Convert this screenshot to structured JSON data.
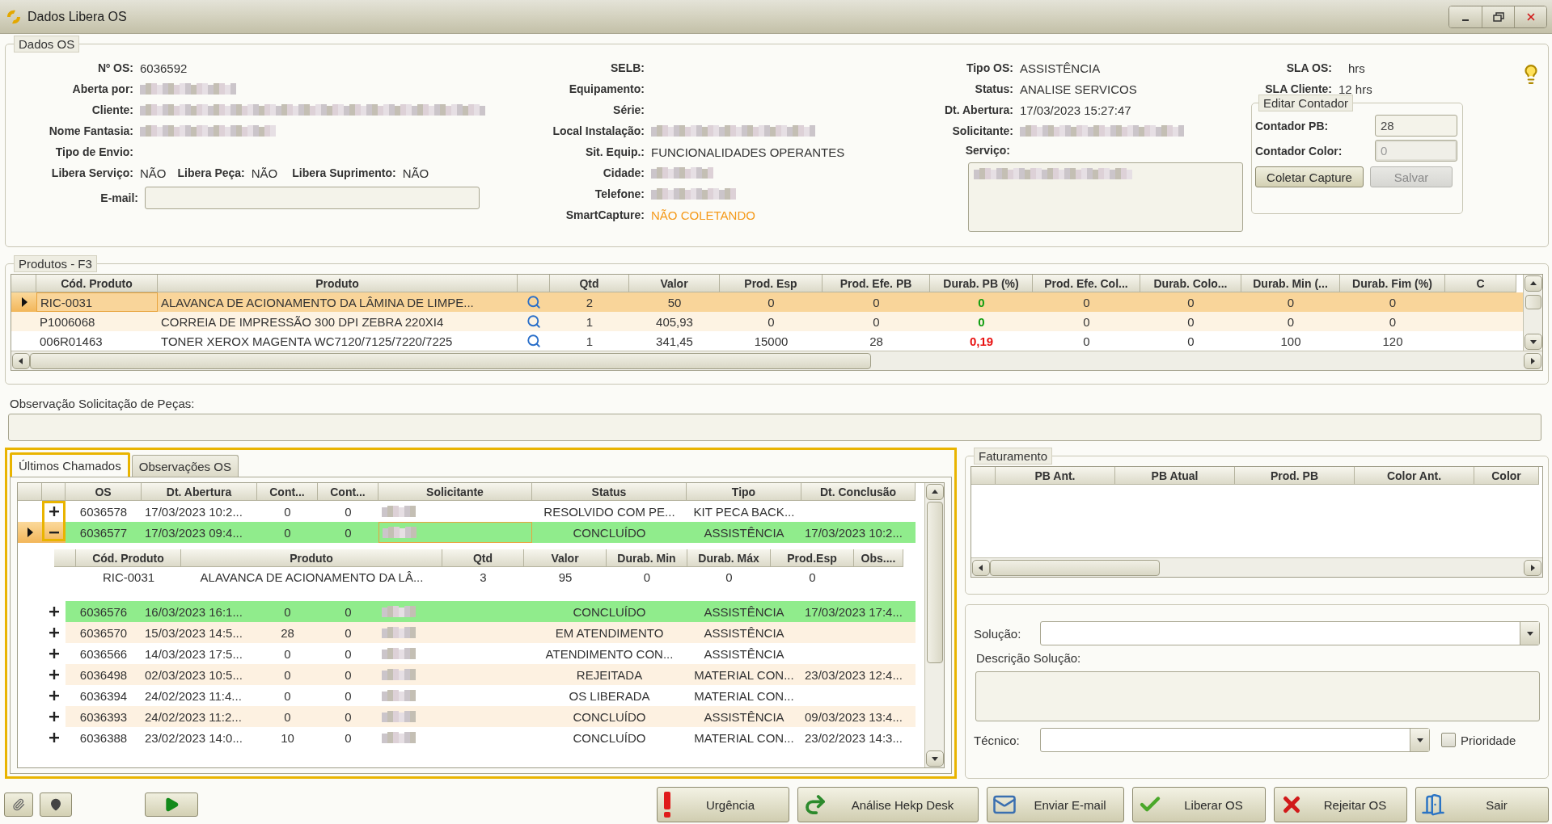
{
  "window": {
    "title": "Dados Libera OS"
  },
  "dados_os": {
    "legend": "Dados OS",
    "col1": [
      {
        "label": "Nº OS:",
        "value": "6036592"
      },
      {
        "label": "Aberta por:",
        "redacted": true
      },
      {
        "label": "Cliente:",
        "redacted": true
      },
      {
        "label": "Nome Fantasia:",
        "redacted": true
      },
      {
        "label": "Tipo de Envio:"
      }
    ],
    "libera": [
      {
        "label": "Libera Serviço:",
        "value": "NÃO"
      },
      {
        "label": "Libera Peça:",
        "value": "NÃO"
      },
      {
        "label": "Libera Suprimento:",
        "value": "NÃO"
      }
    ],
    "email": {
      "label": "E-mail:"
    },
    "col2": [
      {
        "label": "SELB:"
      },
      {
        "label": "Equipamento:"
      },
      {
        "label": "Série:"
      },
      {
        "label": "Local Instalação:",
        "redacted": true
      },
      {
        "label": "Sit. Equip.:",
        "value": "FUNCIONALIDADES OPERANTES"
      },
      {
        "label": "Cidade:",
        "redacted": true
      },
      {
        "label": "Telefone:",
        "redacted": true
      },
      {
        "label": "SmartCapture:",
        "value": "NÃO COLETANDO",
        "alert": true
      }
    ],
    "col3": [
      {
        "label": "Tipo OS:",
        "value": "ASSISTÊNCIA"
      },
      {
        "label": "Status:",
        "value": "ANALISE SERVICOS"
      },
      {
        "label": "Dt. Abertura:",
        "value": "17/03/2023 15:27:47"
      },
      {
        "label": "Solicitante:",
        "redacted": true
      }
    ],
    "servico": {
      "label": "Serviço:",
      "redacted": true
    },
    "sla": [
      {
        "label": "SLA OS:",
        "value": "hrs"
      },
      {
        "label": "SLA Cliente:",
        "value": "12 hrs"
      }
    ],
    "contador": {
      "legend": "Editar Contador",
      "fields": [
        {
          "label": "Contador PB:",
          "value": "28",
          "disabled": false
        },
        {
          "label": "Contador Color:",
          "value": "0",
          "disabled": true
        }
      ],
      "buttons": [
        {
          "label": "Coletar Capture",
          "disabled": false
        },
        {
          "label": "Salvar",
          "disabled": true
        }
      ]
    }
  },
  "produtos": {
    "legend": "Produtos - F3",
    "columns": [
      "Cód. Produto",
      "Produto",
      "Qtd",
      "Valor",
      "Prod. Esp",
      "Prod. Efe. PB",
      "Durab. PB (%)",
      "Prod. Efe. Col...",
      "Durab. Colo...",
      "Durab. Min (...",
      "Durab. Fim (%)",
      "C"
    ],
    "rows": [
      {
        "selected": true,
        "cod": "RIC-0031",
        "produto": "ALAVANCA DE ACIONAMENTO DA LÂMINA DE LIMPE...",
        "qtd": "2",
        "valor": "50",
        "prod_esp": "0",
        "prod_efe_pb": "0",
        "durab_pb": "0",
        "durab_pb_ok": true,
        "prod_efe_col": "0",
        "durab_col": "0",
        "durab_min": "0",
        "durab_fim": "0"
      },
      {
        "selected": false,
        "cod": "P1006068",
        "produto": "CORREIA DE IMPRESSÃO 300 DPI ZEBRA 220XI4",
        "qtd": "1",
        "valor": "405,93",
        "prod_esp": "0",
        "prod_efe_pb": "0",
        "durab_pb": "0",
        "durab_pb_ok": true,
        "prod_efe_col": "0",
        "durab_col": "0",
        "durab_min": "0",
        "durab_fim": "0"
      },
      {
        "selected": false,
        "cod": "006R01463",
        "produto": "TONER XEROX MAGENTA WC7120/7125/7220/7225",
        "qtd": "1",
        "valor": "341,45",
        "prod_esp": "15000",
        "prod_efe_pb": "28",
        "durab_pb": "0,19",
        "durab_pb_ok": false,
        "prod_efe_col": "0",
        "durab_col": "0",
        "durab_min": "100",
        "durab_fim": "120"
      }
    ]
  },
  "observacao": {
    "label": "Observação Solicitação de Peças:"
  },
  "tabs": [
    {
      "label": "Últimos Chamados",
      "selected": true
    },
    {
      "label": "Observações OS",
      "selected": false
    }
  ],
  "chamados": {
    "columns": [
      "OS",
      "Dt. Abertura",
      "Cont...",
      "Cont...",
      "Solicitante",
      "Status",
      "Tipo",
      "Dt. Conclusão"
    ],
    "detail_columns": [
      "Cód. Produto",
      "Produto",
      "Qtd",
      "Valor",
      "Durab. Min",
      "Durab. Máx",
      "Prod.Esp",
      "Obs...."
    ],
    "rows": [
      {
        "os": "6036578",
        "abertura": "17/03/2023 10:2...",
        "cont1": "0",
        "cont2": "0",
        "status": "RESOLVIDO COM PE...",
        "tipo": "KIT PECA BACK...",
        "selected": false,
        "expanded": false,
        "highlight": false
      },
      {
        "os": "6036577",
        "abertura": "17/03/2023 09:4...",
        "cont1": "0",
        "cont2": "0",
        "status": "CONCLUÍDO",
        "tipo": "ASSISTÊNCIA",
        "conclusao": "17/03/2023 10:2...",
        "selected": true,
        "expanded": true,
        "highlight": true,
        "items": [
          {
            "cod": "RIC-0031",
            "produto": "ALAVANCA DE ACIONAMENTO DA LÂ...",
            "qtd": "3",
            "valor": "95",
            "durab_min": "0",
            "durab_max": "0",
            "prod_esp": "0"
          }
        ]
      },
      {
        "os": "6036576",
        "abertura": "16/03/2023 16:1...",
        "cont1": "0",
        "cont2": "0",
        "status": "CONCLUÍDO",
        "tipo": "ASSISTÊNCIA",
        "conclusao": "17/03/2023 17:4...",
        "selected": false,
        "expanded": false,
        "highlight": true
      },
      {
        "os": "6036570",
        "abertura": "15/03/2023 14:5...",
        "cont1": "28",
        "cont2": "0",
        "status": "EM ATENDIMENTO",
        "tipo": "ASSISTÊNCIA",
        "selected": false,
        "expanded": false,
        "highlight": false
      },
      {
        "os": "6036566",
        "abertura": "14/03/2023 17:5...",
        "cont1": "0",
        "cont2": "0",
        "status": "ATENDIMENTO CON...",
        "tipo": "ASSISTÊNCIA",
        "selected": false,
        "expanded": false,
        "highlight": false
      },
      {
        "os": "6036498",
        "abertura": "02/03/2023 10:5...",
        "cont1": "0",
        "cont2": "0",
        "status": "REJEITADA",
        "tipo": "MATERIAL CON...",
        "conclusao": "23/03/2023 12:4...",
        "selected": false,
        "expanded": false,
        "highlight": false
      },
      {
        "os": "6036394",
        "abertura": "24/02/2023 11:4...",
        "cont1": "0",
        "cont2": "0",
        "status": "OS LIBERADA",
        "tipo": "MATERIAL CON...",
        "selected": false,
        "expanded": false,
        "highlight": false
      },
      {
        "os": "6036393",
        "abertura": "24/02/2023 11:2...",
        "cont1": "0",
        "cont2": "0",
        "status": "CONCLUÍDO",
        "tipo": "ASSISTÊNCIA",
        "conclusao": "09/03/2023 13:4...",
        "selected": false,
        "expanded": false,
        "highlight": false
      },
      {
        "os": "6036388",
        "abertura": "23/02/2023 14:0...",
        "cont1": "10",
        "cont2": "0",
        "status": "CONCLUÍDO",
        "tipo": "MATERIAL CON...",
        "conclusao": "23/02/2023 14:3...",
        "selected": false,
        "expanded": false,
        "highlight": false
      }
    ]
  },
  "faturamento": {
    "legend": "Faturamento",
    "columns": [
      "PB Ant.",
      "PB Atual",
      "Prod. PB",
      "Color Ant.",
      "Color"
    ]
  },
  "solucao": {
    "solucao_label": "Solução:",
    "descricao_label": "Descrição Solução:",
    "tecnico_label": "Técnico:",
    "prioridade": {
      "label": "Prioridade",
      "checked": false
    }
  },
  "tools": [
    {
      "kind": "attach"
    },
    {
      "kind": "location"
    },
    {
      "kind": "play"
    }
  ],
  "actions": [
    {
      "label": "Urgência",
      "kind": "urgent"
    },
    {
      "label": "Análise Hekp Desk",
      "kind": "forward"
    },
    {
      "label": "Enviar E-mail",
      "kind": "mail"
    },
    {
      "label": "Liberar OS",
      "kind": "approve"
    },
    {
      "label": "Rejeitar OS",
      "kind": "reject"
    },
    {
      "label": "Sair",
      "kind": "exit"
    }
  ]
}
